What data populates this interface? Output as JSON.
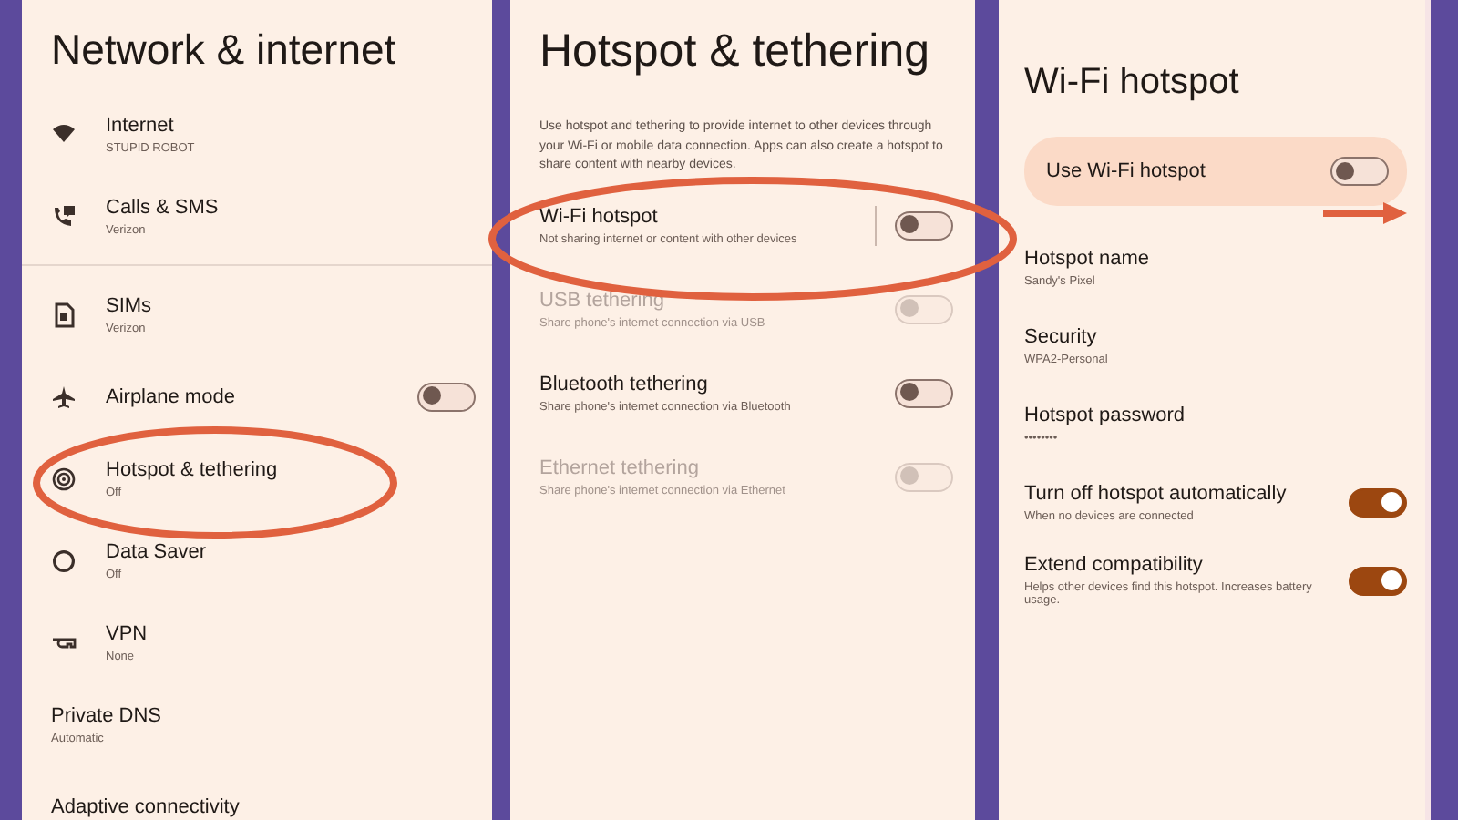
{
  "panels": [
    {
      "kind": "list",
      "title": "Network & internet",
      "sections": [
        {
          "items": [
            {
              "title": "Internet",
              "subtitle": "STUPID ROBOT",
              "highlighted": false
            },
            {
              "title": "Calls & SMS",
              "subtitle": "Verizon",
              "highlighted": false
            }
          ]
        },
        {
          "items": [
            {
              "title": "SIMs",
              "subtitle": "Verizon",
              "highlighted": false
            },
            {
              "title": "Airplane mode",
              "toggle": {
                "on": false,
                "disabled": false
              },
              "highlighted": false
            },
            {
              "title": "Hotspot & tethering",
              "subtitle": "Off",
              "highlighted": true
            },
            {
              "title": "Data Saver",
              "subtitle": "Off",
              "highlighted": false
            },
            {
              "title": "VPN",
              "subtitle": "None",
              "highlighted": false
            },
            {
              "title": "Private DNS",
              "subtitle": "Automatic",
              "highlighted": false
            },
            {
              "title": "Adaptive connectivity",
              "highlighted": false
            }
          ]
        }
      ]
    },
    {
      "kind": "tethering",
      "title": "Hotspot & tethering",
      "description": "Use hotspot and tethering to provide internet to other devices through your Wi-Fi or mobile data connection. Apps can also create a hotspot to share content with nearby devices.",
      "items": [
        {
          "title": "Wi-Fi hotspot",
          "subtitle": "Not sharing internet or content with other devices",
          "toggle": {
            "on": false,
            "disabled": false
          },
          "highlighted": true
        },
        {
          "title": "USB tethering",
          "subtitle": "Share phone's internet connection via USB",
          "toggle": {
            "on": false,
            "disabled": true
          },
          "highlighted": false
        },
        {
          "title": "Bluetooth tethering",
          "subtitle": "Share phone's internet connection via Bluetooth",
          "toggle": {
            "on": false,
            "disabled": false
          },
          "highlighted": false
        },
        {
          "title": "Ethernet tethering",
          "subtitle": "Share phone's internet connection via Ethernet",
          "toggle": {
            "on": false,
            "disabled": true
          },
          "highlighted": false
        }
      ]
    },
    {
      "kind": "hotspot",
      "title": "Wi-Fi hotspot",
      "main_switch": {
        "label": "Use Wi-Fi hotspot",
        "toggle": {
          "on": false,
          "disabled": false
        },
        "arrow": true
      },
      "items": [
        {
          "title": "Hotspot name",
          "subtitle": "Sandy's Pixel"
        },
        {
          "title": "Security",
          "subtitle": "WPA2-Personal"
        },
        {
          "title": "Hotspot password",
          "subtitle": "••••••••"
        },
        {
          "title": "Turn off hotspot automatically",
          "subtitle": "When no devices are connected",
          "toggle": {
            "on": true,
            "disabled": false
          }
        },
        {
          "title": "Extend compatibility",
          "subtitle": "Helps other devices find this hotspot. Increases battery usage.",
          "toggle": {
            "on": true,
            "disabled": false
          }
        }
      ]
    }
  ]
}
